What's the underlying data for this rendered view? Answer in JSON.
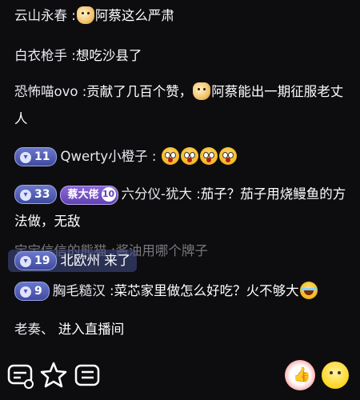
{
  "messages": [
    {
      "user": "云山永春",
      "sep": " :",
      "text": "阿蔡这么严肃"
    },
    {
      "user": "白衣枪手",
      "sep": " :",
      "text": "想吃沙县了"
    },
    {
      "user": "恐怖喵ovo",
      "sep": " :",
      "text_a": "贡献了几百个赞，",
      "text_b": "阿蔡能出一期征服老丈人"
    },
    {
      "level": "11",
      "user": "Qwerty小橙子",
      "sep": " :"
    },
    {
      "level": "33",
      "fan_name": "蔡大佬",
      "fan_level": "10",
      "user": "六分仪-犹大",
      "sep": " :",
      "text": "茄子？茄子用烧鳗鱼的方法做，无敌"
    },
    {
      "ghost": "宝宝信信的熊猫",
      "sep": " :",
      "text": "酱油用哪个牌子"
    },
    {
      "level": "9",
      "user": "胸毛糙汉",
      "sep": " :",
      "text": "菜芯家里做怎么好吃？火不够大"
    },
    {
      "user": "老奏、",
      "text": " 进入直播间"
    }
  ],
  "overlay": {
    "level": "19",
    "text": "北欧州 来了"
  },
  "bottom": {
    "icons": [
      "chat-bubble-icon",
      "star-icon",
      "list-icon",
      "like-icon",
      "emoji-icon"
    ]
  },
  "colors": {
    "background": "#0d0d0f",
    "level_badge": "#5360b8",
    "fan_badge": "#7451c8"
  }
}
